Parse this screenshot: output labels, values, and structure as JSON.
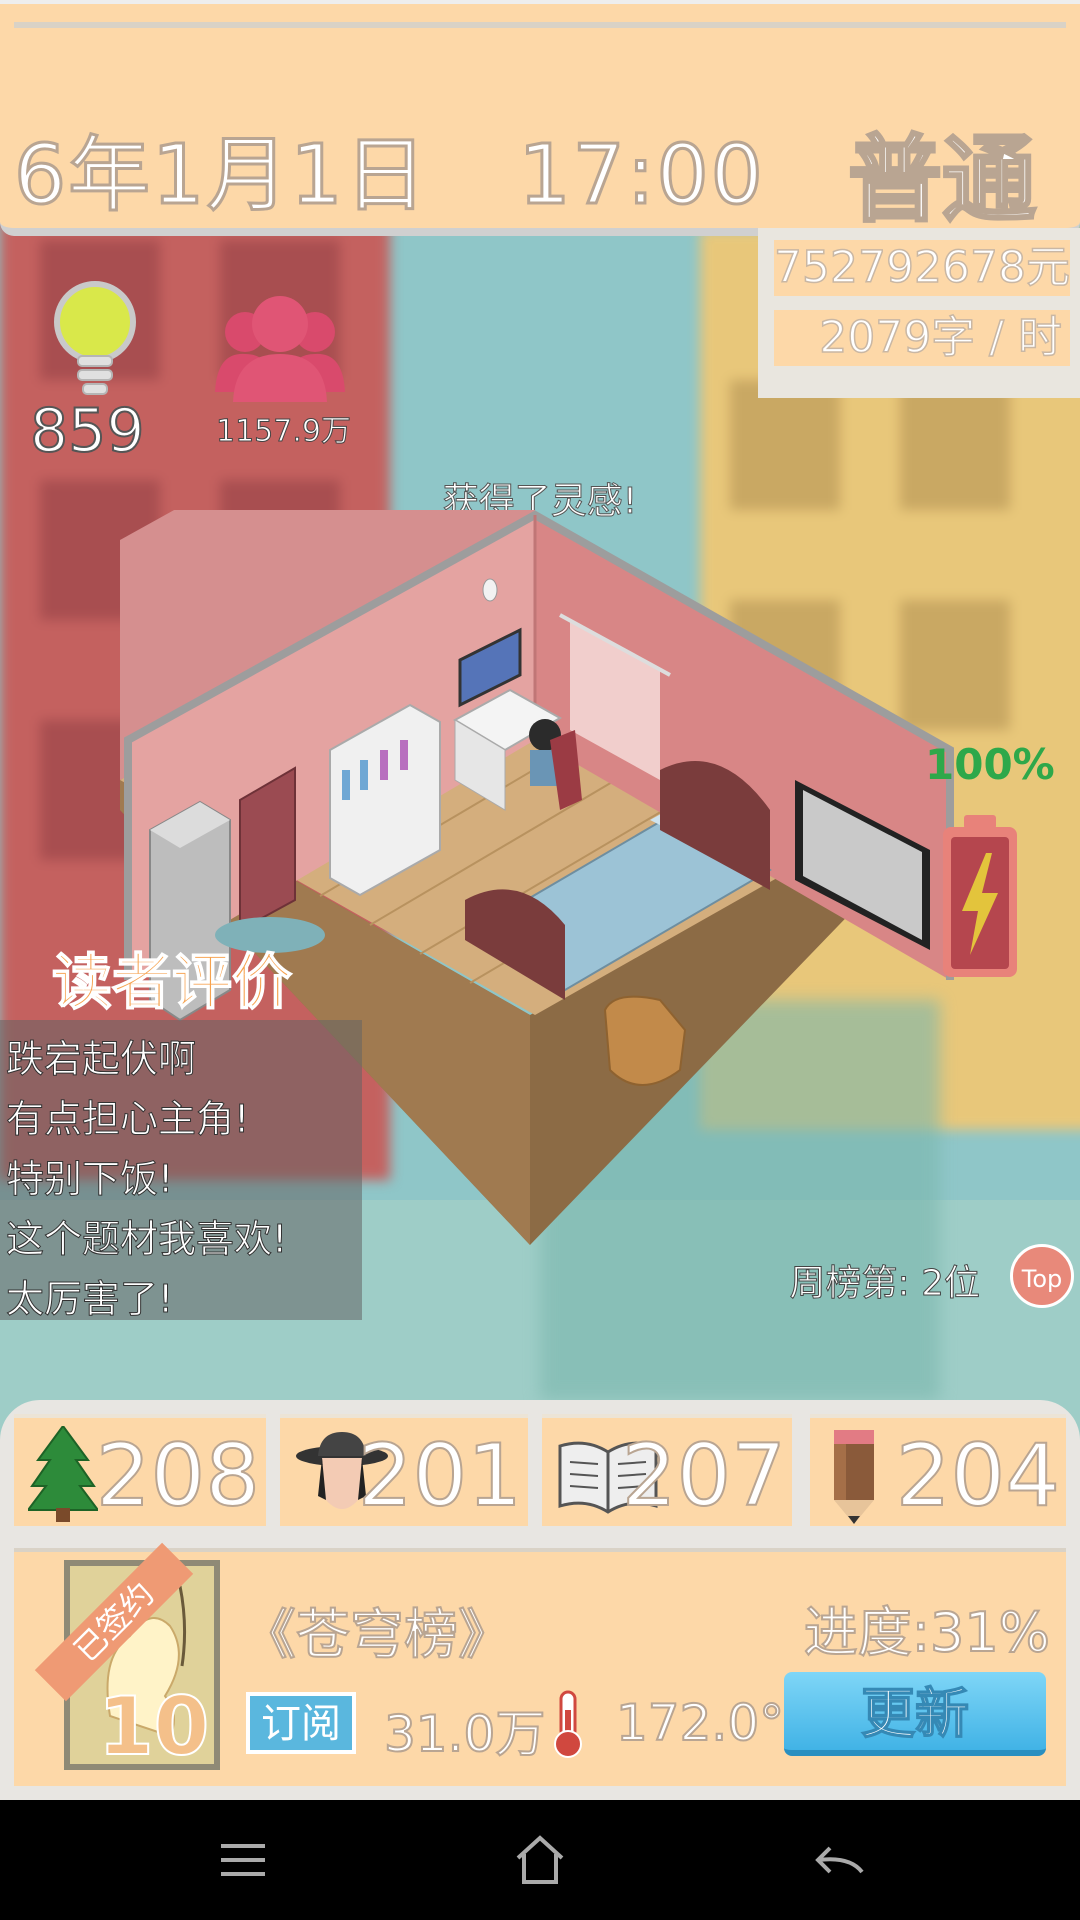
{
  "header": {
    "date": "6年1月1日",
    "time": "17:00",
    "difficulty": "普通"
  },
  "finance": {
    "money": "752792678元",
    "speed": "2079字 / 时"
  },
  "stats": {
    "inspiration": "859",
    "fans": "1157.9万",
    "energy": "100%"
  },
  "event": {
    "message": "获得了灵感!"
  },
  "reviews": {
    "title": "读者评价",
    "items": [
      "跌宕起伏啊",
      "有点担心主角!",
      "特别下饭!",
      "这个题材我喜欢!",
      "太厉害了!"
    ]
  },
  "ranking": {
    "text": "周榜第: 2位",
    "button": "Top"
  },
  "attributes": [
    {
      "icon": "tree-icon",
      "value": "208"
    },
    {
      "icon": "detective-icon",
      "value": "201"
    },
    {
      "icon": "book-icon",
      "value": "207"
    },
    {
      "icon": "pencil-icon",
      "value": "204"
    }
  ],
  "book": {
    "signed_label": "已签约",
    "cover_number": "10",
    "title": "《苍穹榜》",
    "progress": "进度:31%",
    "subscribe_label": "订阅",
    "subscribers": "31.0万",
    "heat": "172.0°",
    "update_button": "更新"
  },
  "colors": {
    "panel": "#fdd8a8",
    "accent_blue": "#41b3e6",
    "battery_red": "#b5464e",
    "energy_green": "#2ea84a"
  }
}
